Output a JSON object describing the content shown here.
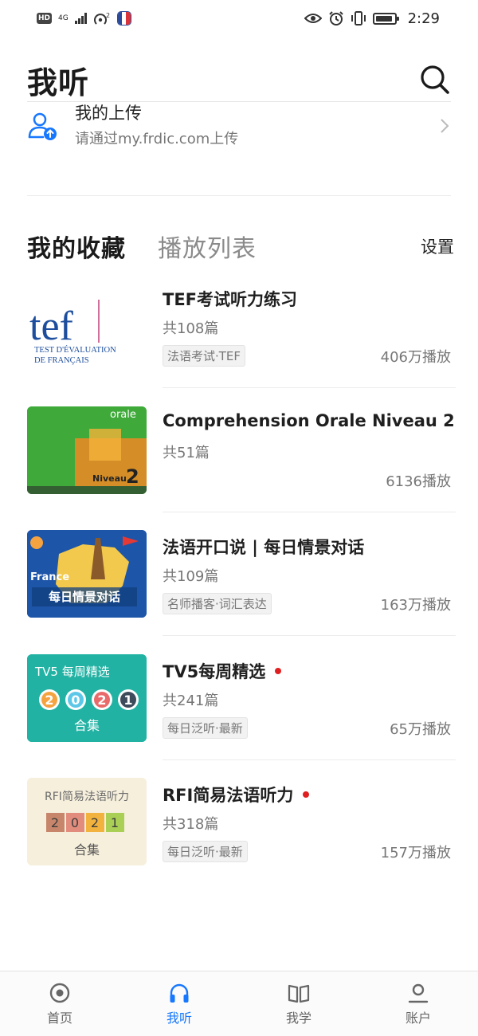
{
  "status_bar": {
    "hd": "HD",
    "network": "4G",
    "wifi_count": "2",
    "time": "2:29"
  },
  "header": {
    "title": "我听",
    "search_icon": "search-icon"
  },
  "upload": {
    "title": "我的上传",
    "subtitle": "请通过my.frdic.com上传",
    "icon": "user-upload-icon"
  },
  "tabs": {
    "favorites": "我的收藏",
    "playlist": "播放列表",
    "settings": "设置"
  },
  "items": [
    {
      "title": "TEF考试听力练习",
      "count": "共108篇",
      "tag": "法语考试·TEF",
      "plays": "406万播放",
      "new": false,
      "cover": {
        "main": "tef",
        "line1": "TEST D'ÉVALUATION",
        "line2": "DE FRANÇAIS"
      }
    },
    {
      "title": "Comprehension Orale Niveau 2",
      "count": "共51篇",
      "tag": "",
      "plays": "6136播放",
      "new": false,
      "cover": {
        "brand": "orale",
        "level_label": "Niveau",
        "level_num": "2"
      }
    },
    {
      "title": "法语开口说 | 每日情景对话",
      "count": "共109篇",
      "tag": "名师播客·词汇表达",
      "plays": "163万播放",
      "new": false,
      "cover": {
        "country": "France",
        "caption": "每日情景对话"
      }
    },
    {
      "title": "TV5每周精选",
      "count": "共241篇",
      "tag": "每日泛听·最新",
      "plays": "65万播放",
      "new": true,
      "cover": {
        "heading": "TV5  每周精选",
        "digits": [
          "2",
          "0",
          "2",
          "1"
        ],
        "caption": "合集"
      }
    },
    {
      "title": "RFI简易法语听力",
      "count": "共318篇",
      "tag": "每日泛听·最新",
      "plays": "157万播放",
      "new": true,
      "cover": {
        "heading": "RFI简易法语听力",
        "digits": [
          "2",
          "0",
          "2",
          "1"
        ],
        "caption": "合集"
      }
    }
  ],
  "bottom_nav": [
    {
      "label": "首页",
      "icon": "home-icon",
      "active": false
    },
    {
      "label": "我听",
      "icon": "headphones-icon",
      "active": true
    },
    {
      "label": "我学",
      "icon": "book-icon",
      "active": false
    },
    {
      "label": "账户",
      "icon": "account-icon",
      "active": false
    }
  ],
  "colors": {
    "accent": "#1677ff",
    "new_dot": "#e02020",
    "tef_blue": "#1d4e9e",
    "tef_pink": "#c2407a"
  }
}
